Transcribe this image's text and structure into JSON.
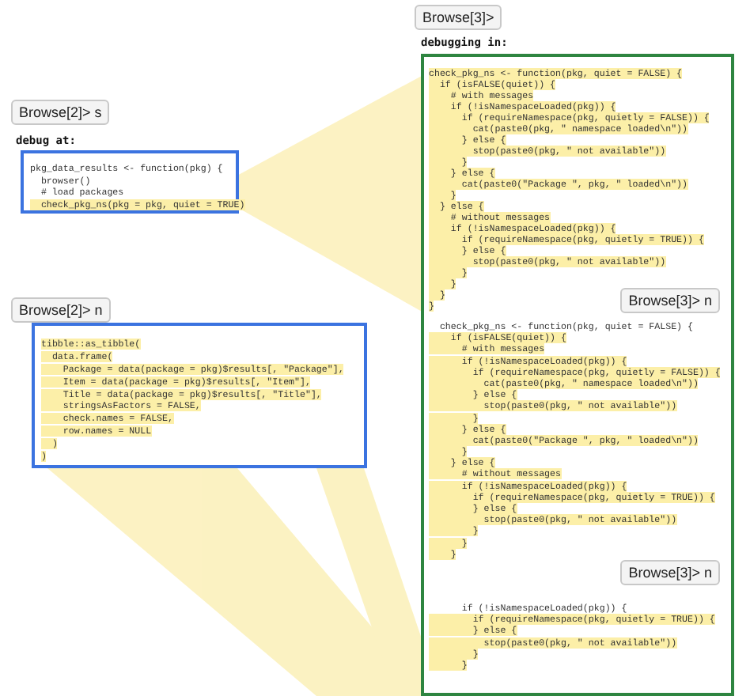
{
  "left": {
    "prompt_step": "Browse[2]> s",
    "debug_label": "debug at:",
    "caller_code": [
      {
        "text": "pkg_data_results <- function(pkg) {",
        "highlighted": false
      },
      {
        "text": "  browser()",
        "highlighted": false
      },
      {
        "text": "  # load packages",
        "highlighted": false
      },
      {
        "text": "  check_pkg_ns(pkg = pkg, quiet = TRUE)",
        "highlighted": true
      }
    ],
    "prompt_next": "Browse[2]> n",
    "next_code": [
      {
        "text": "tibble::as_tibble(",
        "highlighted": true
      },
      {
        "text": "  data.frame(",
        "highlighted": true
      },
      {
        "text": "    Package = data(package = pkg)$results[, \"Package\"],",
        "highlighted": true
      },
      {
        "text": "    Item = data(package = pkg)$results[, \"Item\"],",
        "highlighted": true
      },
      {
        "text": "    Title = data(package = pkg)$results[, \"Title\"],",
        "highlighted": true
      },
      {
        "text": "    stringsAsFactors = FALSE,",
        "highlighted": true
      },
      {
        "text": "    check.names = FALSE,",
        "highlighted": true
      },
      {
        "text": "    row.names = NULL",
        "highlighted": true
      },
      {
        "text": "  )",
        "highlighted": true
      },
      {
        "text": ")",
        "highlighted": true
      }
    ]
  },
  "right": {
    "prompt": "Browse[3]>",
    "debugging_label": "debugging in:",
    "blocks": [
      {
        "prompt_after": "Browse[3]> n",
        "lines": [
          {
            "text": "check_pkg_ns <- function(pkg, quiet = FALSE) {",
            "highlighted": true
          },
          {
            "text": "  if (isFALSE(quiet)) {",
            "highlighted": true
          },
          {
            "text": "    # with messages",
            "highlighted": true
          },
          {
            "text": "    if (!isNamespaceLoaded(pkg)) {",
            "highlighted": true
          },
          {
            "text": "      if (requireNamespace(pkg, quietly = FALSE)) {",
            "highlighted": true
          },
          {
            "text": "        cat(paste0(pkg, \" namespace loaded\\n\"))",
            "highlighted": true
          },
          {
            "text": "      } else {",
            "highlighted": true
          },
          {
            "text": "        stop(paste0(pkg, \" not available\"))",
            "highlighted": true
          },
          {
            "text": "      }",
            "highlighted": true
          },
          {
            "text": "    } else {",
            "highlighted": true
          },
          {
            "text": "      cat(paste0(\"Package \", pkg, \" loaded\\n\"))",
            "highlighted": true
          },
          {
            "text": "    }",
            "highlighted": true
          },
          {
            "text": "  } else {",
            "highlighted": true
          },
          {
            "text": "    # without messages",
            "highlighted": true
          },
          {
            "text": "    if (!isNamespaceLoaded(pkg)) {",
            "highlighted": true
          },
          {
            "text": "      if (requireNamespace(pkg, quietly = TRUE)) {",
            "highlighted": true
          },
          {
            "text": "      } else {",
            "highlighted": true
          },
          {
            "text": "        stop(paste0(pkg, \" not available\"))",
            "highlighted": true
          },
          {
            "text": "      }",
            "highlighted": true
          },
          {
            "text": "    }",
            "highlighted": true
          },
          {
            "text": "  }",
            "highlighted": true
          },
          {
            "text": "}",
            "highlighted": true
          }
        ]
      },
      {
        "prompt_after": "Browse[3]> n",
        "lines": [
          {
            "text": "  check_pkg_ns <- function(pkg, quiet = FALSE) {",
            "highlighted": false
          },
          {
            "text": "    if (isFALSE(quiet)) {",
            "highlighted": true
          },
          {
            "text": "      # with messages",
            "highlighted": true
          },
          {
            "text": "      if (!isNamespaceLoaded(pkg)) {",
            "highlighted": true
          },
          {
            "text": "        if (requireNamespace(pkg, quietly = FALSE)) {",
            "highlighted": true
          },
          {
            "text": "          cat(paste0(pkg, \" namespace loaded\\n\"))",
            "highlighted": true
          },
          {
            "text": "        } else {",
            "highlighted": true
          },
          {
            "text": "          stop(paste0(pkg, \" not available\"))",
            "highlighted": true
          },
          {
            "text": "        }",
            "highlighted": true
          },
          {
            "text": "      } else {",
            "highlighted": true
          },
          {
            "text": "        cat(paste0(\"Package \", pkg, \" loaded\\n\"))",
            "highlighted": true
          },
          {
            "text": "      }",
            "highlighted": true
          },
          {
            "text": "    } else {",
            "highlighted": true
          },
          {
            "text": "      # without messages",
            "highlighted": true
          },
          {
            "text": "      if (!isNamespaceLoaded(pkg)) {",
            "highlighted": true
          },
          {
            "text": "        if (requireNamespace(pkg, quietly = TRUE)) {",
            "highlighted": true
          },
          {
            "text": "        } else {",
            "highlighted": true
          },
          {
            "text": "          stop(paste0(pkg, \" not available\"))",
            "highlighted": true
          },
          {
            "text": "        }",
            "highlighted": true
          },
          {
            "text": "      }",
            "highlighted": true
          },
          {
            "text": "    }",
            "highlighted": true
          }
        ]
      },
      {
        "lines": [
          {
            "text": "      if (!isNamespaceLoaded(pkg)) {",
            "highlighted": false
          },
          {
            "text": "        if (requireNamespace(pkg, quietly = TRUE)) {",
            "highlighted": true
          },
          {
            "text": "        } else {",
            "highlighted": true
          },
          {
            "text": "          stop(paste0(pkg, \" not available\"))",
            "highlighted": true
          },
          {
            "text": "        }",
            "highlighted": true
          },
          {
            "text": "      }",
            "highlighted": true
          }
        ]
      }
    ]
  }
}
